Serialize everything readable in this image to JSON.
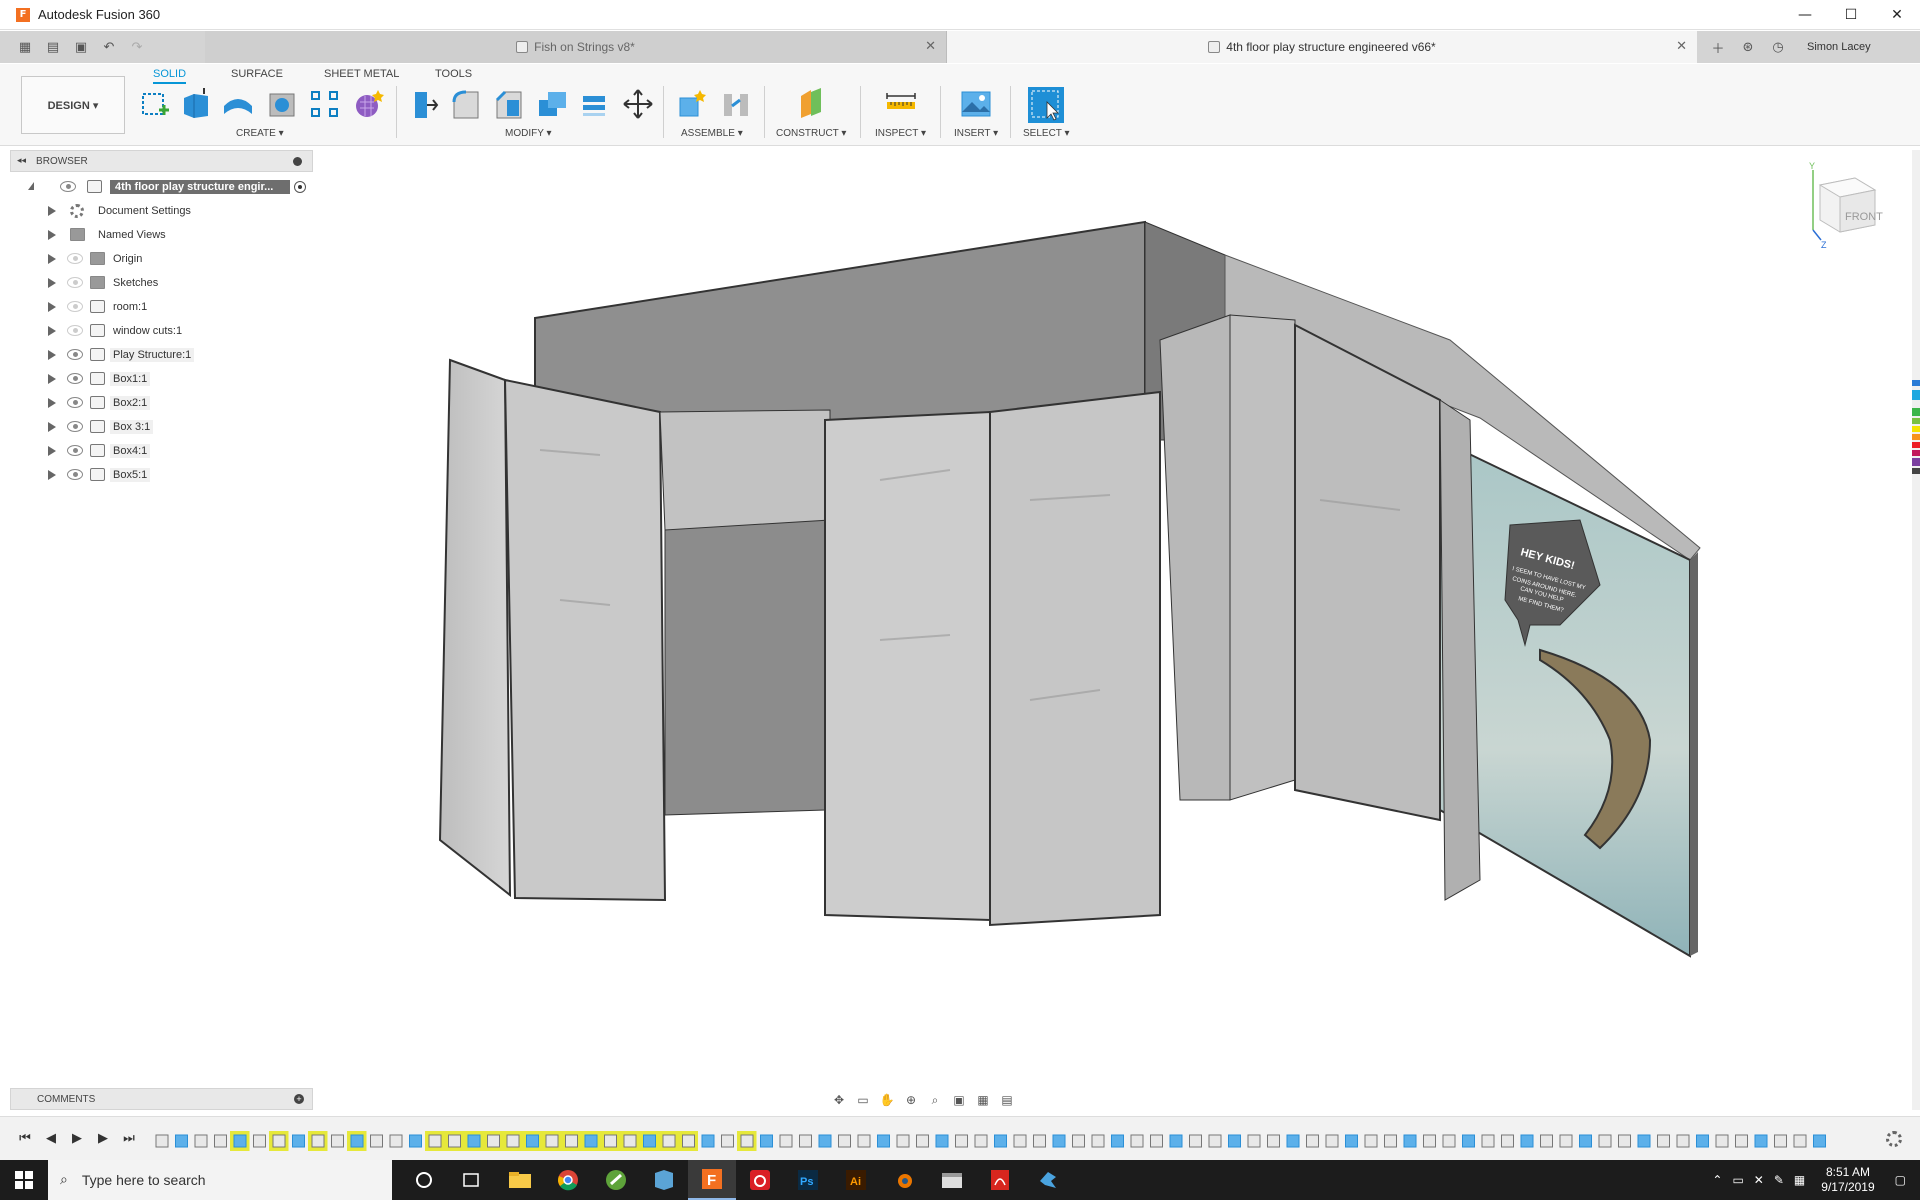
{
  "window": {
    "app_title": "Autodesk Fusion 360",
    "minimize": "—",
    "maximize": "☐",
    "close": "✕"
  },
  "tabs": {
    "items": [
      {
        "label": "Fish on Strings v8*",
        "active": false
      },
      {
        "label": "4th floor play structure engineered v66*",
        "active": true
      }
    ],
    "user": "Simon Lacey"
  },
  "toolbar": {
    "workspace": "DESIGN ▾",
    "workspace_tabs": [
      "SOLID",
      "SURFACE",
      "SHEET METAL",
      "TOOLS"
    ],
    "groups": {
      "create": "CREATE ▾",
      "modify": "MODIFY ▾",
      "assemble": "ASSEMBLE ▾",
      "construct": "CONSTRUCT ▾",
      "inspect": "INSPECT ▾",
      "insert": "INSERT ▾",
      "select": "SELECT ▾"
    }
  },
  "browser": {
    "title": "BROWSER",
    "root": "4th floor play structure engir...",
    "items": [
      {
        "label": "Document Settings",
        "icon": "gear-icon"
      },
      {
        "label": "Named Views",
        "icon": "folder-icon"
      },
      {
        "label": "Origin",
        "icon": "folder-icon"
      },
      {
        "label": "Sketches",
        "icon": "folder-icon"
      },
      {
        "label": "room:1",
        "icon": "component-icon"
      },
      {
        "label": "window cuts:1",
        "icon": "component-icon"
      },
      {
        "label": "Play Structure:1",
        "icon": "component-icon"
      },
      {
        "label": "Box1:1",
        "icon": "component-icon"
      },
      {
        "label": "Box2:1",
        "icon": "component-icon"
      },
      {
        "label": "Box 3:1",
        "icon": "component-icon"
      },
      {
        "label": "Box4:1",
        "icon": "component-icon"
      },
      {
        "label": "Box5:1",
        "icon": "component-icon"
      }
    ]
  },
  "comments": {
    "title": "COMMENTS"
  },
  "viewcube": {
    "face": "FRONT",
    "axis_y": "Y",
    "axis_z": "Z"
  },
  "model": {
    "sign_title": "HEY KIDS!",
    "sign_line1": "I SEEM TO HAVE LOST MY",
    "sign_line2": "COINS AROUND HERE.",
    "sign_line3": "CAN YOU HELP",
    "sign_line4": "ME FIND THEM?"
  },
  "taskbar": {
    "search_placeholder": "Type here to search",
    "time": "8:51 AM",
    "date": "9/17/2019"
  },
  "colors": {
    "accent": "#0696d7",
    "active_tab_bg": "#f5f5f5",
    "taskbar_bg": "#1c1c1c",
    "timeline_highlight": "#e6e83a"
  }
}
